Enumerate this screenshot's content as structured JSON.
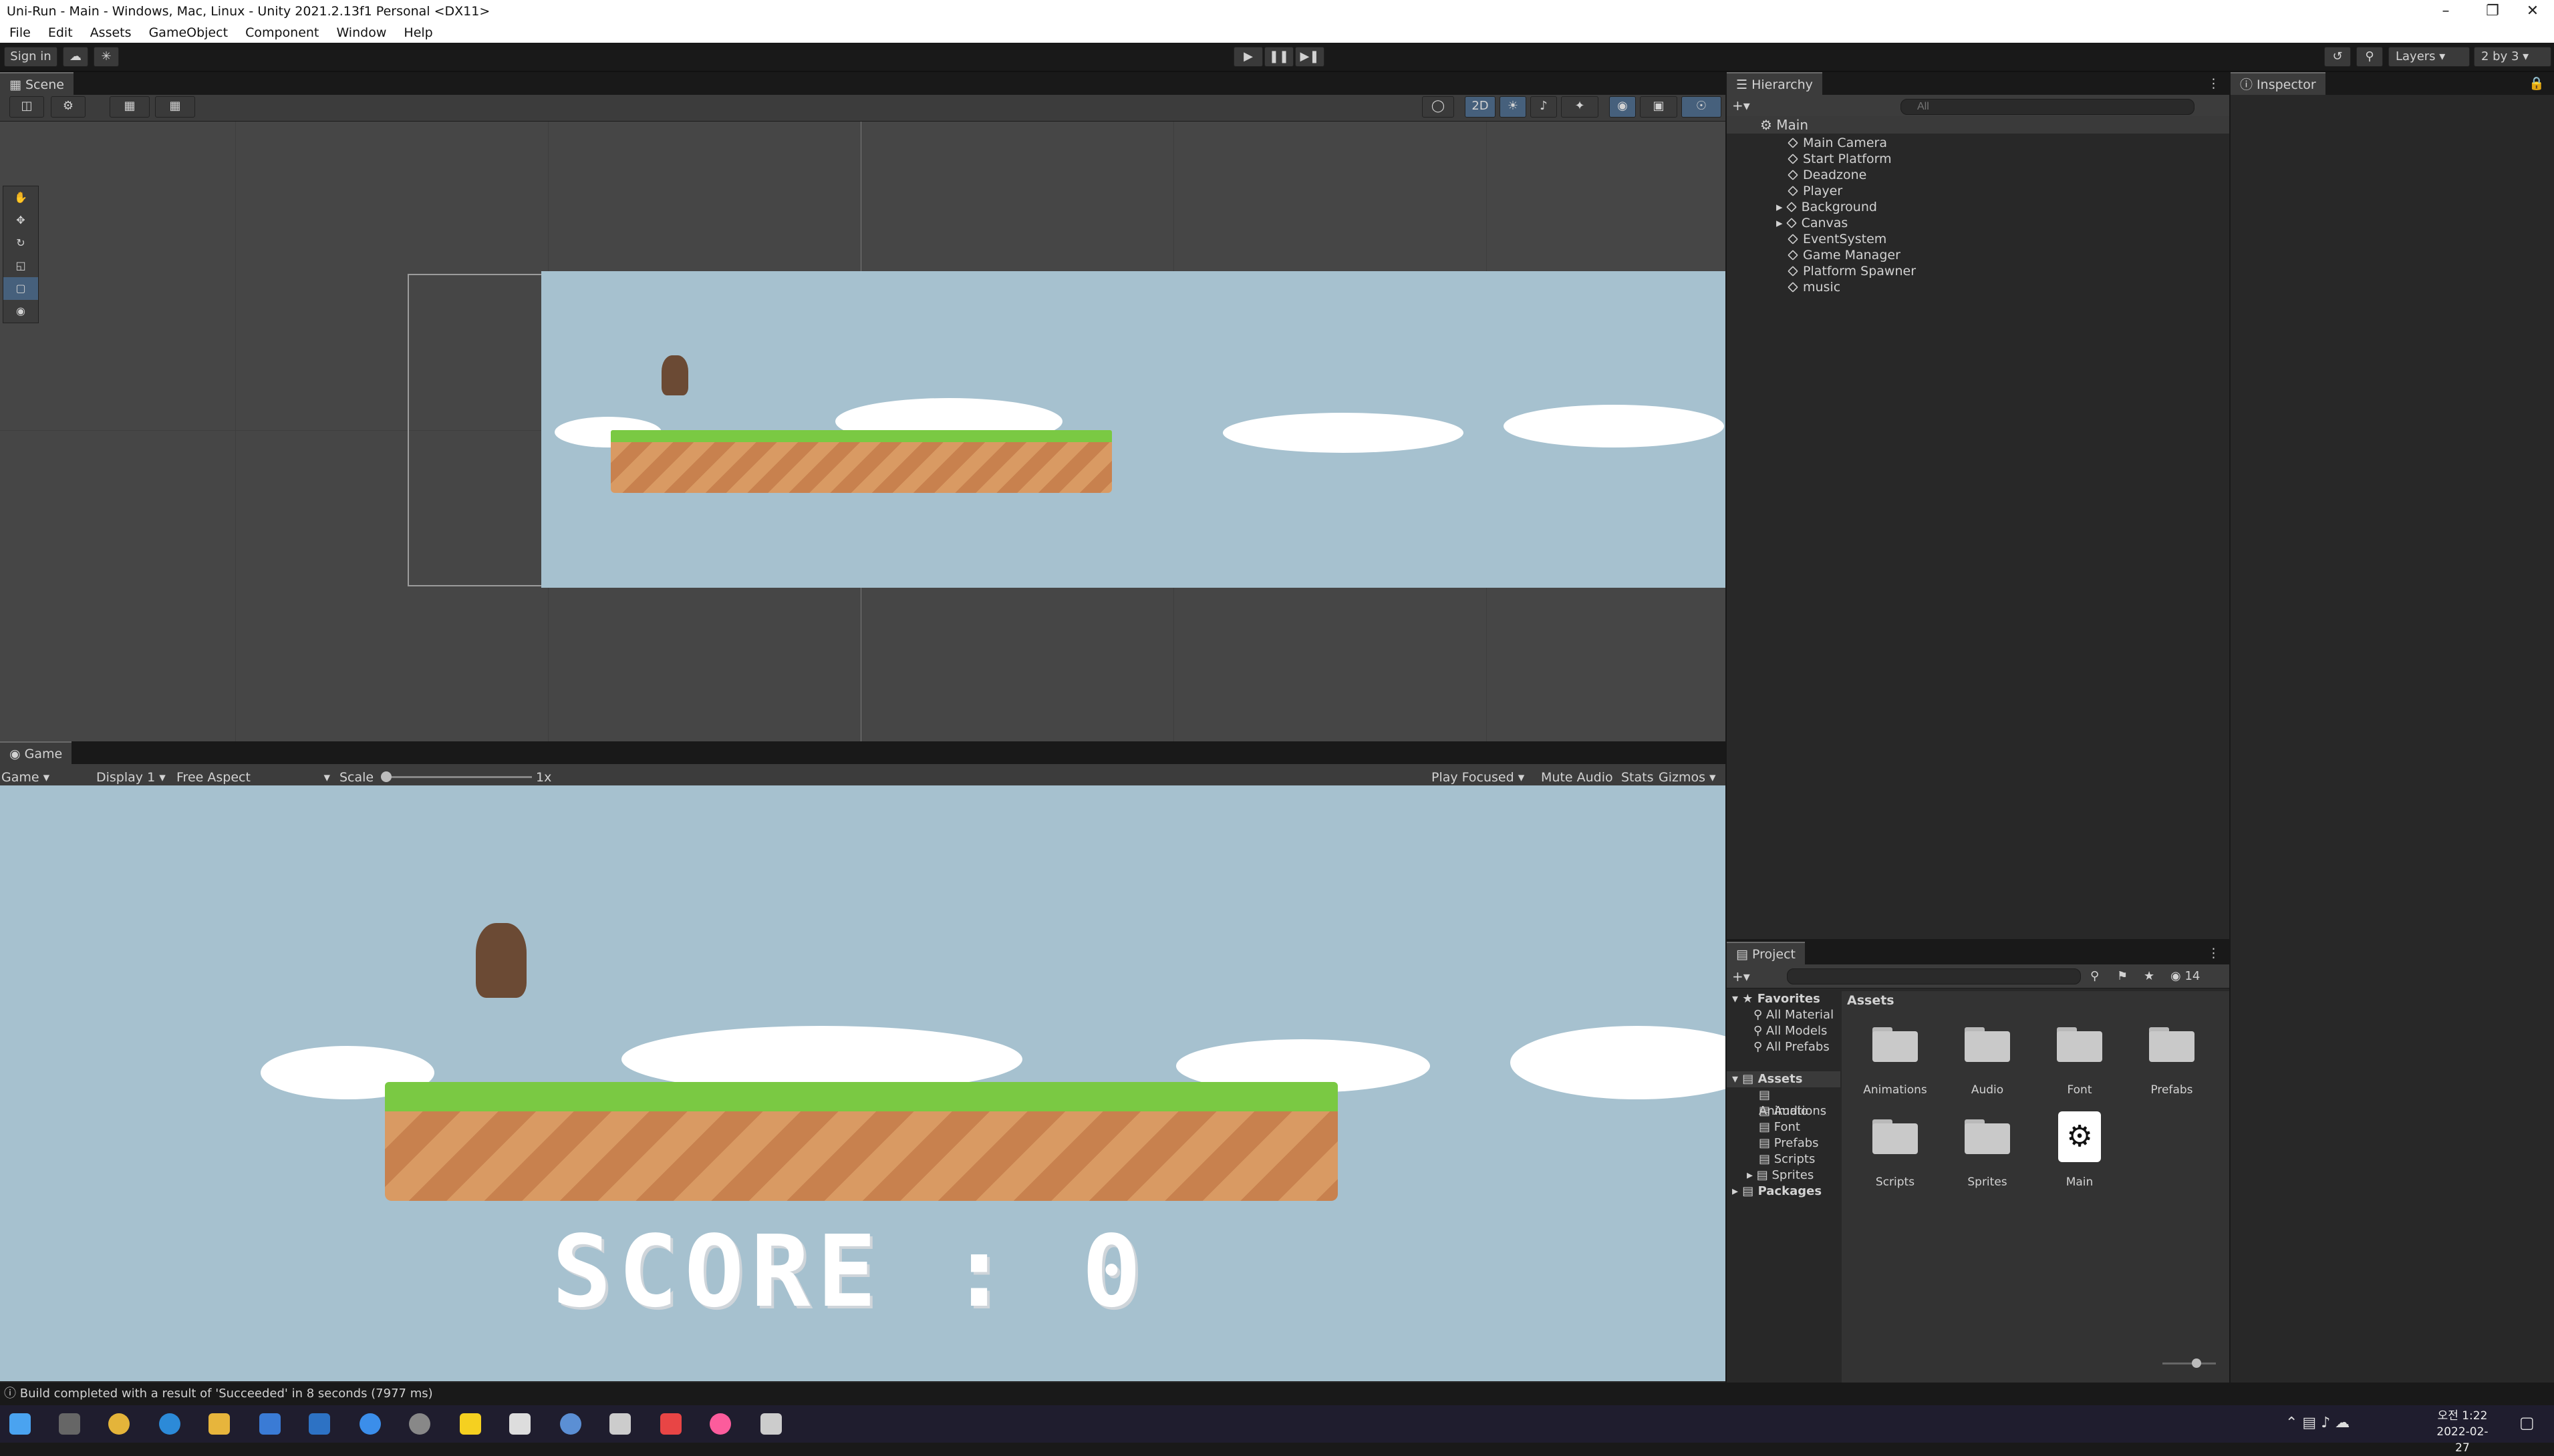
{
  "window": {
    "title": "Uni-Run - Main - Windows, Mac, Linux - Unity 2021.2.13f1 Personal <DX11>"
  },
  "menu": [
    "File",
    "Edit",
    "Assets",
    "GameObject",
    "Component",
    "Window",
    "Help"
  ],
  "toolbar": {
    "sign_in": "Sign in",
    "layers": "Layers",
    "layout": "2 by 3"
  },
  "scene": {
    "tab": "Scene",
    "mode_2d": "2D"
  },
  "game": {
    "tab": "Game",
    "view_select": "Game",
    "display": "Display 1",
    "aspect": "Free Aspect",
    "scale_label": "Scale",
    "scale_value": "1x",
    "play_focused": "Play Focused",
    "mute_audio": "Mute Audio",
    "stats": "Stats",
    "gizmos": "Gizmos",
    "score_text": "SCORE : 0"
  },
  "hierarchy": {
    "tab": "Hierarchy",
    "search_placeholder": "All",
    "scene_name": "Main",
    "items": [
      "Main Camera",
      "Start Platform",
      "Deadzone",
      "Player",
      "Background",
      "Canvas",
      "EventSystem",
      "Game Manager",
      "Platform Spawner",
      "music"
    ]
  },
  "inspector": {
    "tab": "Inspector"
  },
  "project": {
    "tab": "Project",
    "count": "14",
    "favorites_label": "Favorites",
    "favorites": [
      "All Material",
      "All Models",
      "All Prefabs"
    ],
    "assets_label": "Assets",
    "folders": [
      "Animations",
      "Audio",
      "Font",
      "Prefabs",
      "Scripts",
      "Sprites"
    ],
    "packages_label": "Packages",
    "breadcrumb": "Assets",
    "grid_items": [
      "Animations",
      "Audio",
      "Font",
      "Prefabs",
      "Scripts",
      "Sprites",
      "Main"
    ]
  },
  "status": {
    "message": "Build completed with a result of 'Succeeded' in 8 seconds (7977 ms)"
  },
  "clock": {
    "time": "오전 1:22",
    "date": "2022-02-27"
  },
  "colors": {
    "sky": "#a6c1cf",
    "grass": "#7ac943",
    "dirt": "#d99a63",
    "editor_bg": "#282828"
  }
}
